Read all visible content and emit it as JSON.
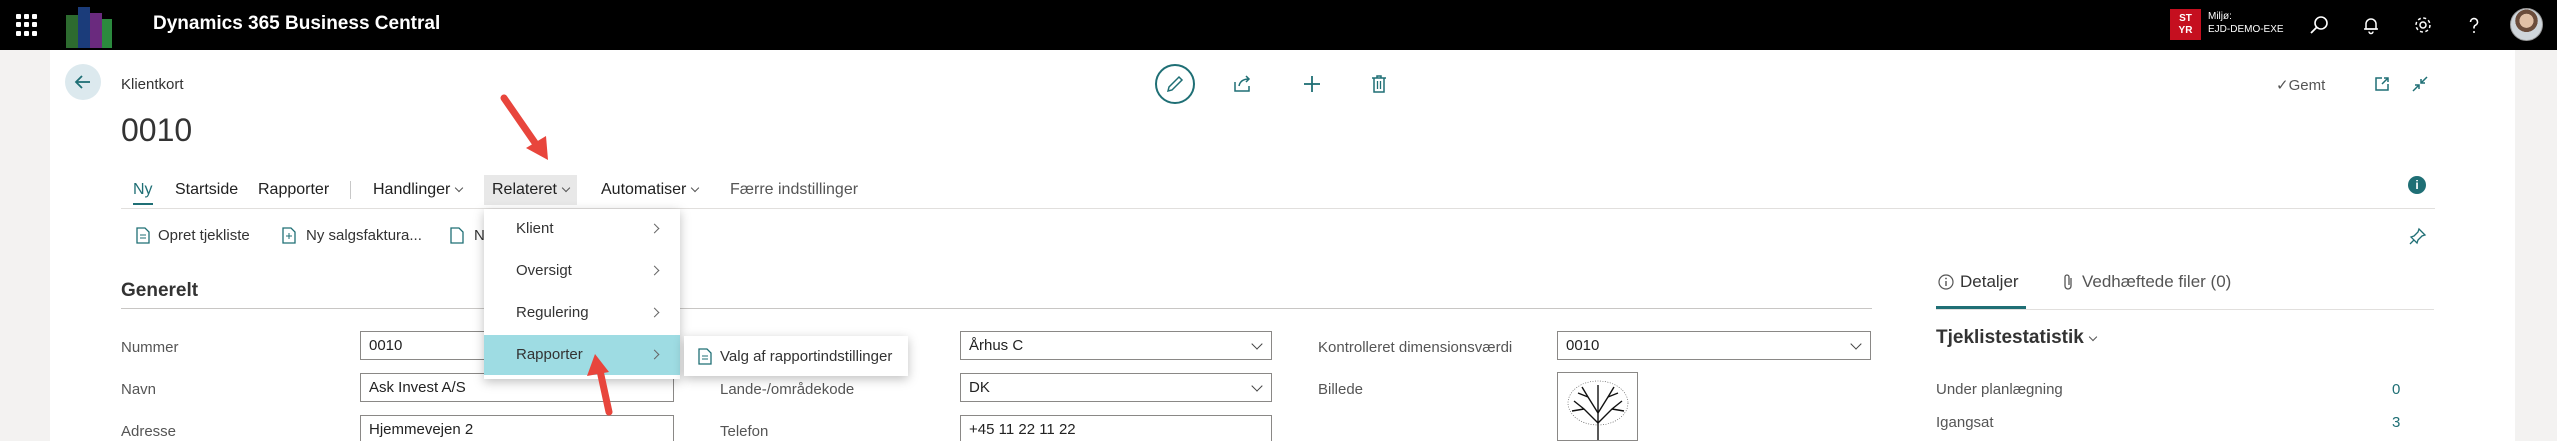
{
  "app": {
    "title": "Dynamics 365 Business Central"
  },
  "environment": {
    "badge_line1": "ST",
    "badge_line2": "YR",
    "label": "Miljø:",
    "name": "EJD-DEMO-EXE"
  },
  "header": {
    "breadcrumb": "Klientkort",
    "title": "0010",
    "saved_label": "Gemt"
  },
  "actionbar": {
    "items": [
      "Ny",
      "Startside",
      "Rapporter",
      "Handlinger",
      "Relateret",
      "Automatiser",
      "Færre indstillinger"
    ],
    "promoted": [
      "Opret tjekliste",
      "Ny salgsfaktura...",
      "N"
    ]
  },
  "menu": {
    "items": [
      "Klient",
      "Oversigt",
      "Regulering",
      "Rapporter"
    ],
    "submenu_item": "Valg af rapportindstillinger"
  },
  "general": {
    "title": "Generelt",
    "labels": {
      "nummer": "Nummer",
      "navn": "Navn",
      "adresse": "Adresse",
      "lande": "Lande-/områdekode",
      "telefon": "Telefon",
      "kontrolleret": "Kontrolleret dimensionsværdi",
      "billede": "Billede"
    },
    "values": {
      "nummer": "0010",
      "navn": "Ask Invest A/S",
      "adresse": "Hjemmevejen 2",
      "by": "Århus C",
      "lande": "DK",
      "telefon": "+45 11 22 11 22",
      "kontrolleret": "0010"
    }
  },
  "factbox": {
    "tabs": [
      "Detaljer",
      "Vedhæftede filer (0)"
    ],
    "stat_title": "Tjeklistestatistik",
    "stats": [
      {
        "label": "Under planlægning",
        "value": "0"
      },
      {
        "label": "Igangsat",
        "value": "3"
      }
    ]
  },
  "colors": {
    "accent": "#1f6f75",
    "highlight": "#9edce3",
    "arrow": "#e8453c",
    "env_badge": "#c50f1f"
  }
}
